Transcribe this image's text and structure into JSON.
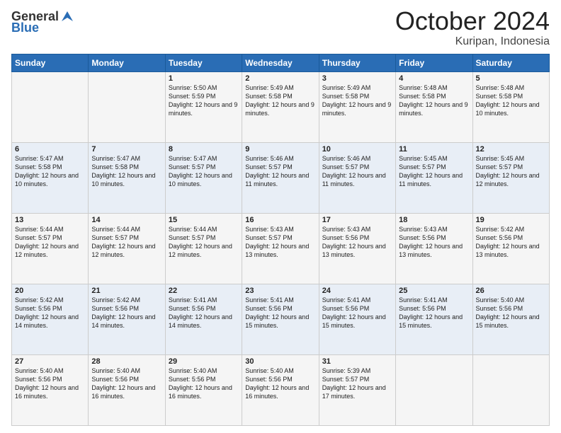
{
  "logo": {
    "general": "General",
    "blue": "Blue"
  },
  "title": "October 2024",
  "subtitle": "Kuripan, Indonesia",
  "days_header": [
    "Sunday",
    "Monday",
    "Tuesday",
    "Wednesday",
    "Thursday",
    "Friday",
    "Saturday"
  ],
  "weeks": [
    [
      {
        "day": "",
        "info": ""
      },
      {
        "day": "",
        "info": ""
      },
      {
        "day": "1",
        "info": "Sunrise: 5:50 AM\nSunset: 5:59 PM\nDaylight: 12 hours and 9 minutes."
      },
      {
        "day": "2",
        "info": "Sunrise: 5:49 AM\nSunset: 5:58 PM\nDaylight: 12 hours and 9 minutes."
      },
      {
        "day": "3",
        "info": "Sunrise: 5:49 AM\nSunset: 5:58 PM\nDaylight: 12 hours and 9 minutes."
      },
      {
        "day": "4",
        "info": "Sunrise: 5:48 AM\nSunset: 5:58 PM\nDaylight: 12 hours and 9 minutes."
      },
      {
        "day": "5",
        "info": "Sunrise: 5:48 AM\nSunset: 5:58 PM\nDaylight: 12 hours and 10 minutes."
      }
    ],
    [
      {
        "day": "6",
        "info": "Sunrise: 5:47 AM\nSunset: 5:58 PM\nDaylight: 12 hours and 10 minutes."
      },
      {
        "day": "7",
        "info": "Sunrise: 5:47 AM\nSunset: 5:58 PM\nDaylight: 12 hours and 10 minutes."
      },
      {
        "day": "8",
        "info": "Sunrise: 5:47 AM\nSunset: 5:57 PM\nDaylight: 12 hours and 10 minutes."
      },
      {
        "day": "9",
        "info": "Sunrise: 5:46 AM\nSunset: 5:57 PM\nDaylight: 12 hours and 11 minutes."
      },
      {
        "day": "10",
        "info": "Sunrise: 5:46 AM\nSunset: 5:57 PM\nDaylight: 12 hours and 11 minutes."
      },
      {
        "day": "11",
        "info": "Sunrise: 5:45 AM\nSunset: 5:57 PM\nDaylight: 12 hours and 11 minutes."
      },
      {
        "day": "12",
        "info": "Sunrise: 5:45 AM\nSunset: 5:57 PM\nDaylight: 12 hours and 12 minutes."
      }
    ],
    [
      {
        "day": "13",
        "info": "Sunrise: 5:44 AM\nSunset: 5:57 PM\nDaylight: 12 hours and 12 minutes."
      },
      {
        "day": "14",
        "info": "Sunrise: 5:44 AM\nSunset: 5:57 PM\nDaylight: 12 hours and 12 minutes."
      },
      {
        "day": "15",
        "info": "Sunrise: 5:44 AM\nSunset: 5:57 PM\nDaylight: 12 hours and 12 minutes."
      },
      {
        "day": "16",
        "info": "Sunrise: 5:43 AM\nSunset: 5:57 PM\nDaylight: 12 hours and 13 minutes."
      },
      {
        "day": "17",
        "info": "Sunrise: 5:43 AM\nSunset: 5:56 PM\nDaylight: 12 hours and 13 minutes."
      },
      {
        "day": "18",
        "info": "Sunrise: 5:43 AM\nSunset: 5:56 PM\nDaylight: 12 hours and 13 minutes."
      },
      {
        "day": "19",
        "info": "Sunrise: 5:42 AM\nSunset: 5:56 PM\nDaylight: 12 hours and 13 minutes."
      }
    ],
    [
      {
        "day": "20",
        "info": "Sunrise: 5:42 AM\nSunset: 5:56 PM\nDaylight: 12 hours and 14 minutes."
      },
      {
        "day": "21",
        "info": "Sunrise: 5:42 AM\nSunset: 5:56 PM\nDaylight: 12 hours and 14 minutes."
      },
      {
        "day": "22",
        "info": "Sunrise: 5:41 AM\nSunset: 5:56 PM\nDaylight: 12 hours and 14 minutes."
      },
      {
        "day": "23",
        "info": "Sunrise: 5:41 AM\nSunset: 5:56 PM\nDaylight: 12 hours and 15 minutes."
      },
      {
        "day": "24",
        "info": "Sunrise: 5:41 AM\nSunset: 5:56 PM\nDaylight: 12 hours and 15 minutes."
      },
      {
        "day": "25",
        "info": "Sunrise: 5:41 AM\nSunset: 5:56 PM\nDaylight: 12 hours and 15 minutes."
      },
      {
        "day": "26",
        "info": "Sunrise: 5:40 AM\nSunset: 5:56 PM\nDaylight: 12 hours and 15 minutes."
      }
    ],
    [
      {
        "day": "27",
        "info": "Sunrise: 5:40 AM\nSunset: 5:56 PM\nDaylight: 12 hours and 16 minutes."
      },
      {
        "day": "28",
        "info": "Sunrise: 5:40 AM\nSunset: 5:56 PM\nDaylight: 12 hours and 16 minutes."
      },
      {
        "day": "29",
        "info": "Sunrise: 5:40 AM\nSunset: 5:56 PM\nDaylight: 12 hours and 16 minutes."
      },
      {
        "day": "30",
        "info": "Sunrise: 5:40 AM\nSunset: 5:56 PM\nDaylight: 12 hours and 16 minutes."
      },
      {
        "day": "31",
        "info": "Sunrise: 5:39 AM\nSunset: 5:57 PM\nDaylight: 12 hours and 17 minutes."
      },
      {
        "day": "",
        "info": ""
      },
      {
        "day": "",
        "info": ""
      }
    ]
  ]
}
